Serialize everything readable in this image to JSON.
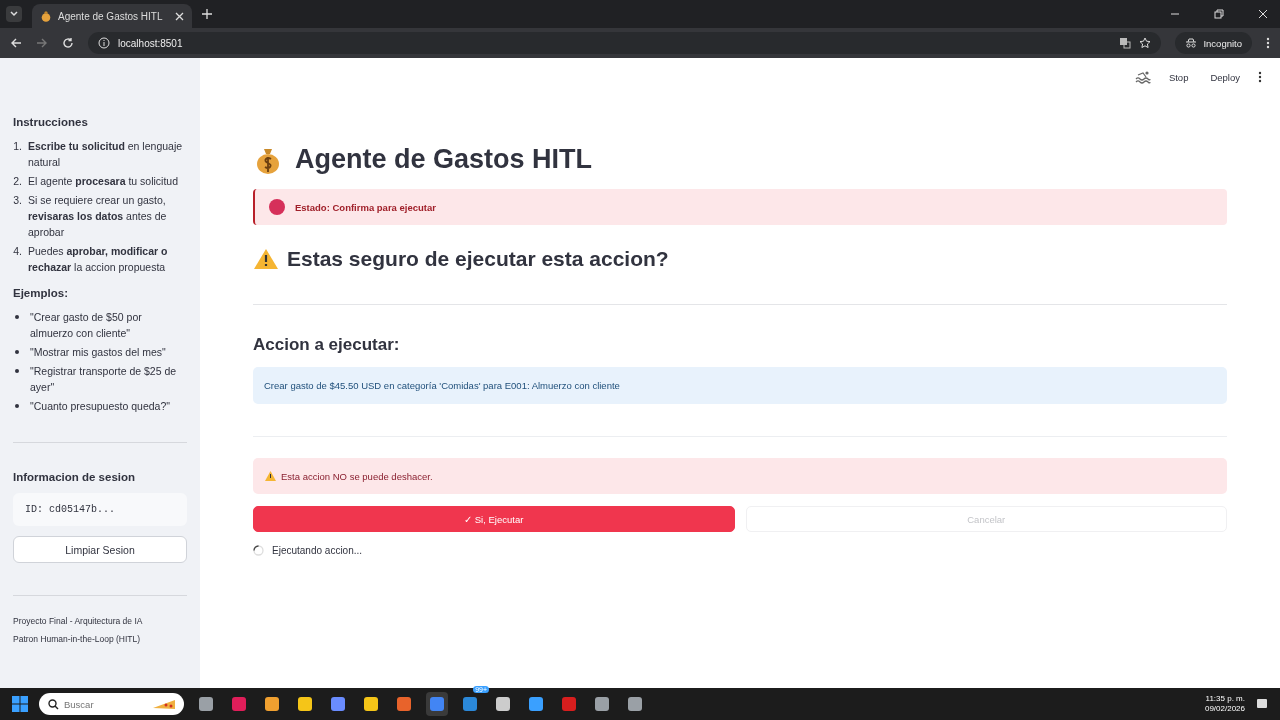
{
  "browser": {
    "tab": {
      "title": "Agente de Gastos HITL",
      "selected": true
    },
    "url": "localhost:8501",
    "profile": "Incognito"
  },
  "app_header": {
    "buttons": [
      "Stop",
      "Deploy"
    ]
  },
  "sidebar": {
    "instructions": {
      "title": "Instrucciones",
      "items": [
        {
          "number": "1.",
          "text": "**Escribe tu solicitud** en lenguaje natural"
        },
        {
          "number": "2.",
          "text": "El agente **procesara** tu solicitud"
        },
        {
          "number": "3.",
          "text": "Si se requiere crear un gasto, **revisaras los datos** antes de aprobar"
        },
        {
          "number": "4.",
          "text": "Puedes **aprobar, modificar o rechazar** la accion propuesta"
        }
      ]
    },
    "examples": {
      "title": "Ejemplos:",
      "items": [
        "\"Crear gasto de $50 por almuerzo con cliente\"",
        "\"Mostrar mis gastos del mes\"",
        "\"Registrar transporte de $25 de ayer\"",
        "\"Cuanto presupuesto queda?\""
      ]
    },
    "session": {
      "title": "Informacion de sesion",
      "id": "ID: cd05147b...",
      "button": "Limpiar Sesion"
    },
    "footer": [
      "Proyecto Final - Arquitectura de IA",
      "Patron Human-in-the-Loop (HITL)"
    ]
  },
  "main": {
    "title": "Agente de Gastos HITL",
    "status": "Estado: Confirma para ejecutar",
    "question": "Estas seguro de ejecutar esta accion?",
    "action_heading": "Accion a ejecutar:",
    "action_text": "Crear gasto de $45.50 USD en categoría 'Comidas' para E001: Almuerzo con cliente",
    "warning": "Esta accion NO se puede deshacer.",
    "buttons": [
      {
        "label": "✓ Si, Ejecutar",
        "kind": "primary",
        "disabled": false
      },
      {
        "label": "Cancelar",
        "kind": "secondary",
        "disabled": true
      }
    ],
    "spinner_text": "Ejecutando accion..."
  },
  "taskbar": {
    "search_placeholder": "Buscar",
    "apps": [
      {
        "selected": false
      },
      {
        "selected": false
      },
      {
        "selected": false
      },
      {
        "selected": false
      },
      {
        "selected": false
      },
      {
        "selected": false
      },
      {
        "selected": false
      },
      {
        "selected": true
      },
      {
        "selected": false
      },
      {
        "selected": false
      },
      {
        "selected": false
      },
      {
        "selected": false
      },
      {
        "selected": false
      },
      {
        "selected": false
      }
    ],
    "badge": "99+",
    "time": "11:35 p. m.",
    "date": "09/02/2026"
  }
}
